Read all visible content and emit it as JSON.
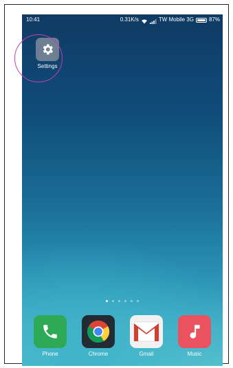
{
  "statusbar": {
    "time": "10:41",
    "speed": "0.31K/s",
    "carrier": "TW Mobile 3G",
    "battery": "87%",
    "battery_level": 0.87
  },
  "home": {
    "apps": [
      {
        "label": "Settings",
        "icon": "gear-icon"
      }
    ],
    "page_count": 6,
    "active_page": 1,
    "highlight_color": "#c23fb0"
  },
  "dock": {
    "apps": [
      {
        "label": "Phone",
        "icon": "phone-icon",
        "color": "#2eaa57"
      },
      {
        "label": "Chrome",
        "icon": "chrome-icon",
        "color": "#222a34"
      },
      {
        "label": "Gmail",
        "icon": "gmail-icon",
        "color": "#f1f1f1"
      },
      {
        "label": "Music",
        "icon": "music-note-icon",
        "color": "#e9525e"
      }
    ]
  }
}
